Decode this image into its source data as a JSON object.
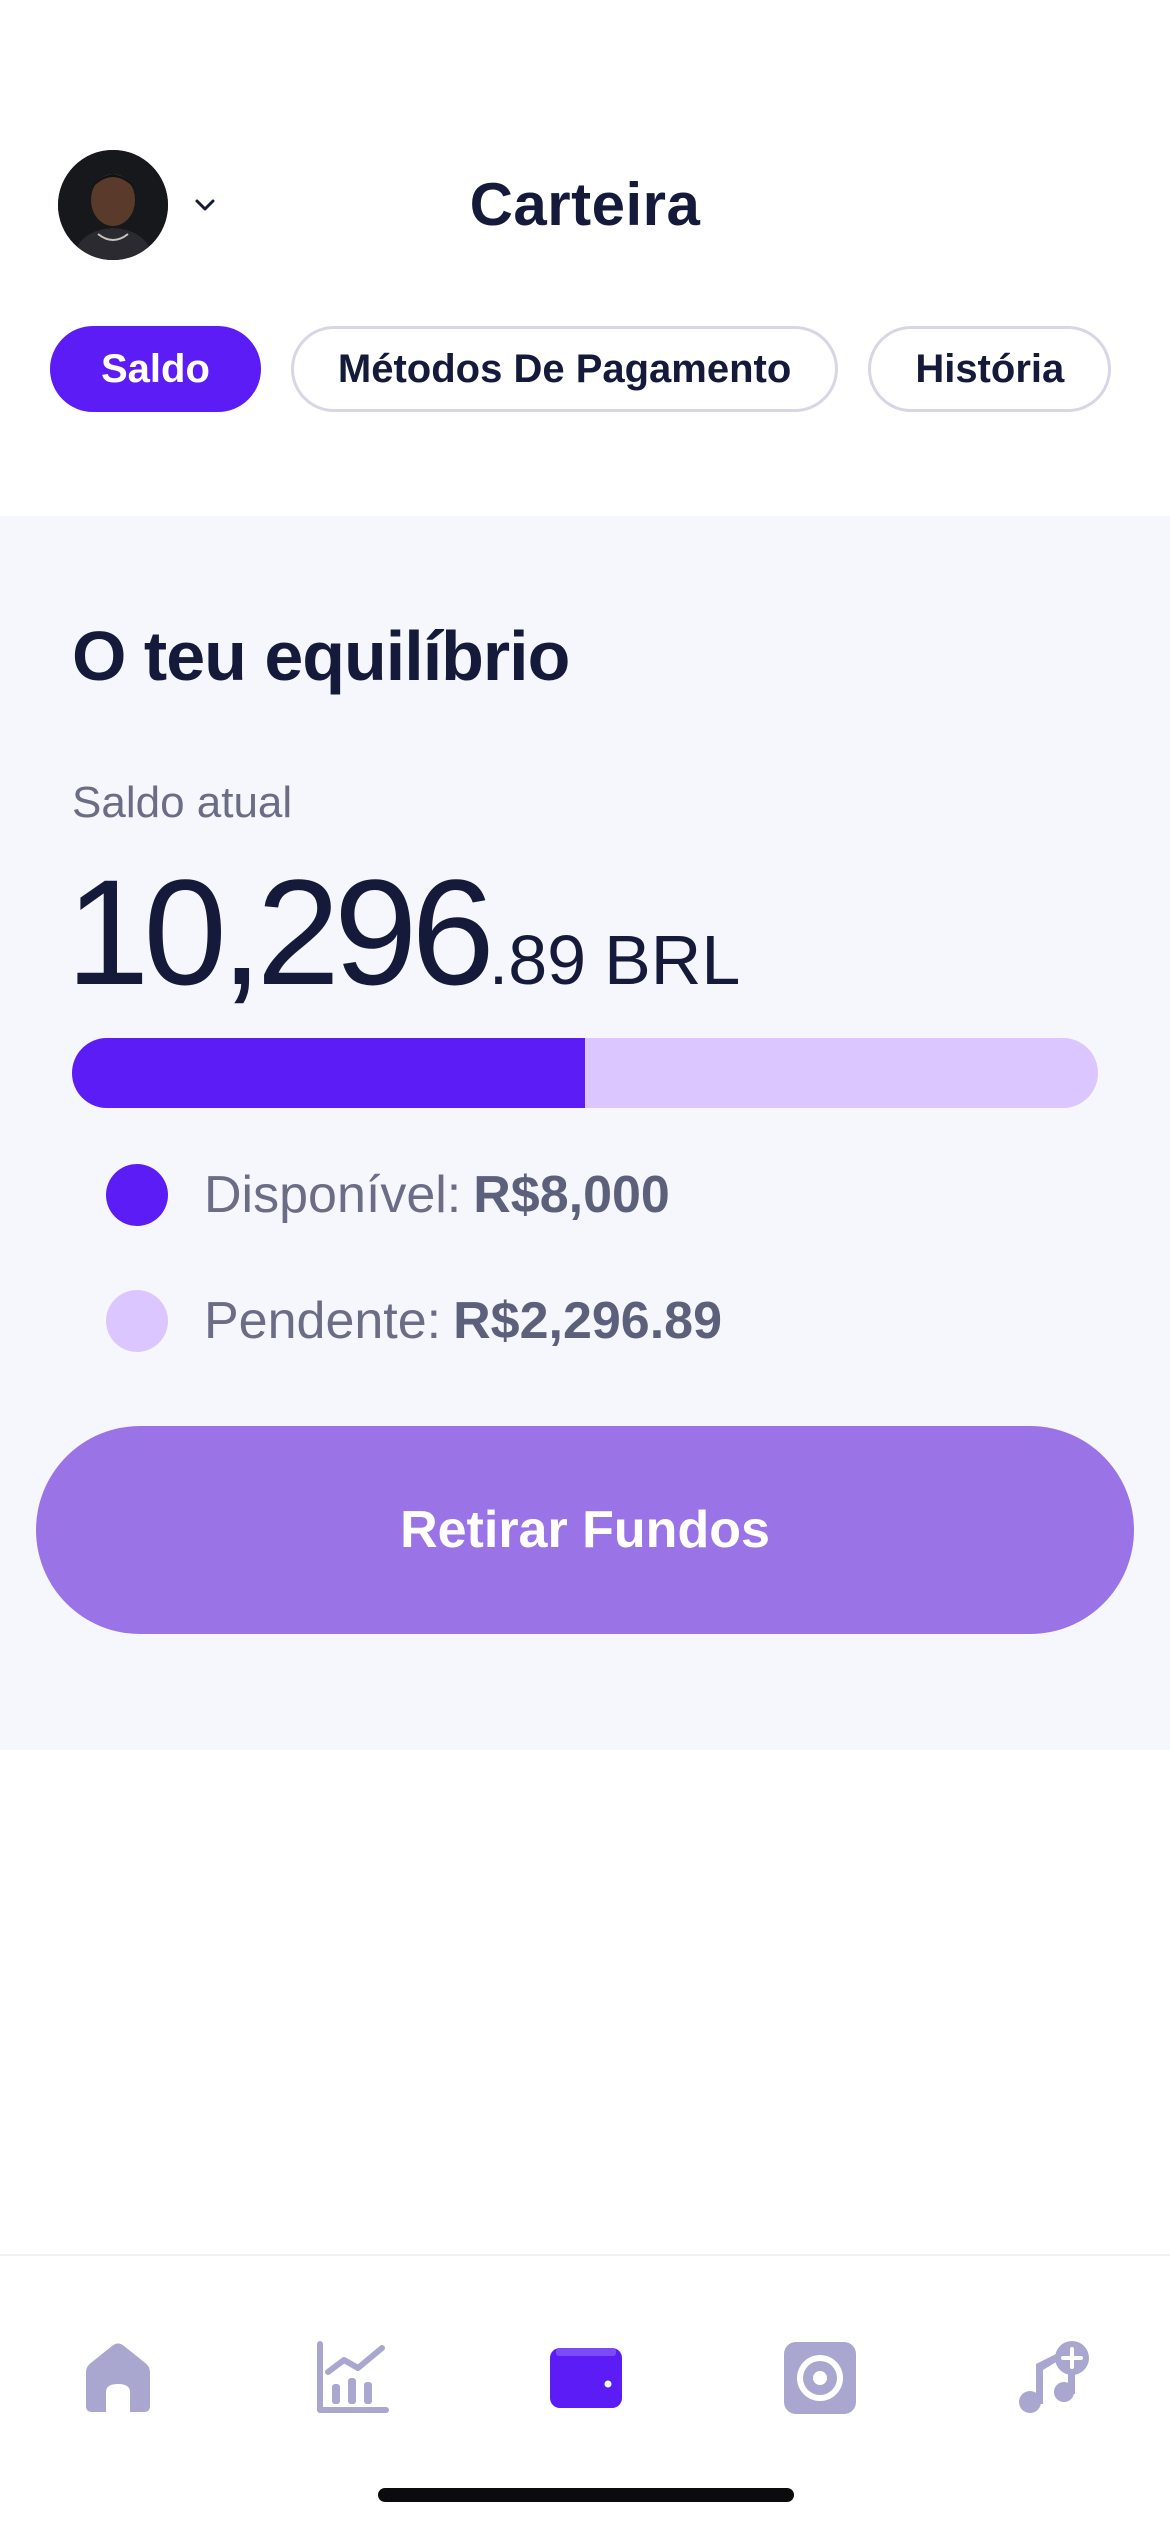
{
  "header": {
    "title": "Carteira",
    "avatar_icon": "user-avatar-photo",
    "chevron_icon": "chevron-down-icon"
  },
  "tabs": [
    {
      "label": "Saldo",
      "active": true
    },
    {
      "label": "Métodos De Pagamento",
      "active": false
    },
    {
      "label": "História",
      "active": false
    }
  ],
  "balance": {
    "title": "O teu equilíbrio",
    "label": "Saldo atual",
    "amount_main": "10,296",
    "amount_cents": ".89",
    "currency": "BRL",
    "available_fraction": 0.5,
    "available_label": "Disponível:",
    "available_value": "R$8,000",
    "pending_label": "Pendente:",
    "pending_value": "R$2,296.89",
    "withdraw_label": "Retirar Fundos"
  },
  "colors": {
    "accent": "#5b1cf5",
    "accent_light": "#dcc6ff",
    "button": "#9a74e6",
    "inactive_icon": "#a9a6cf",
    "text_dark": "#151a3a"
  },
  "bottom_nav": [
    {
      "icon": "home-icon",
      "active": false
    },
    {
      "icon": "stats-chart-icon",
      "active": false
    },
    {
      "icon": "wallet-icon",
      "active": true
    },
    {
      "icon": "vinyl-record-icon",
      "active": false
    },
    {
      "icon": "add-music-icon",
      "active": false
    }
  ]
}
